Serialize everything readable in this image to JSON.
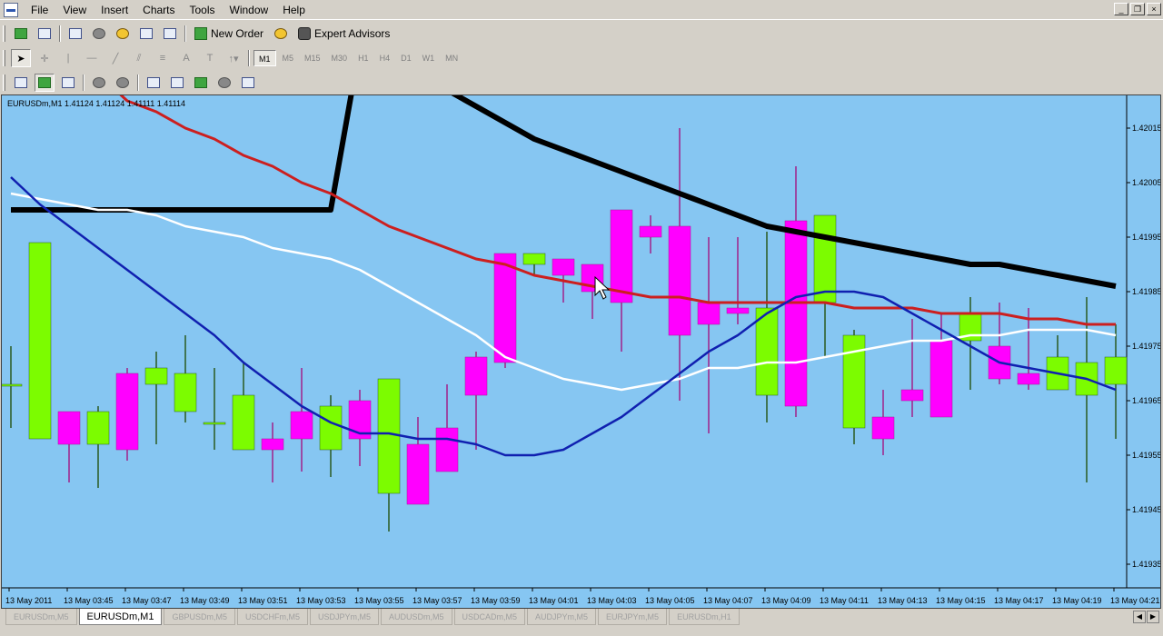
{
  "menubar": {
    "items": [
      "File",
      "View",
      "Insert",
      "Charts",
      "Tools",
      "Window",
      "Help"
    ]
  },
  "toolbar1": {
    "new_order_label": "New Order",
    "expert_advisors_label": "Expert Advisors"
  },
  "timeframes": [
    "M1",
    "M5",
    "M15",
    "M30",
    "H1",
    "H4",
    "D1",
    "W1",
    "MN"
  ],
  "active_timeframe": "M1",
  "chart": {
    "info_line": "EURUSDm,M1  1.41124  1.41124  1.41111  1.41114",
    "background": "#86c6f2",
    "bull_color": "#7cfc00",
    "bear_color": "#ff00ff",
    "cursor_icon": "arrow-cursor-icon"
  },
  "chart_data": {
    "type": "candlestick",
    "symbol": "EURUSDm",
    "timeframe": "M1",
    "ylim": [
      1.41935,
      1.42025
    ],
    "y_ticks": [
      "1.42015",
      "1.42005",
      "1.41995",
      "1.41985",
      "1.41975",
      "1.41965",
      "1.41955",
      "1.41945",
      "1.41935"
    ],
    "y_tick_values": [
      1.42015,
      1.42005,
      1.41995,
      1.41985,
      1.41975,
      1.41965,
      1.41955,
      1.41945,
      1.41935
    ],
    "x_labels": [
      "13 May 2011",
      "13 May 03:45",
      "13 May 03:47",
      "13 May 03:49",
      "13 May 03:51",
      "13 May 03:53",
      "13 May 03:55",
      "13 May 03:57",
      "13 May 03:59",
      "13 May 04:01",
      "13 May 04:03",
      "13 May 04:05",
      "13 May 04:07",
      "13 May 04:09",
      "13 May 04:11",
      "13 May 04:13",
      "13 May 04:15",
      "13 May 04:17",
      "13 May 04:19",
      "13 May 04:21"
    ],
    "candles": [
      {
        "o": 1.41968,
        "h": 1.41975,
        "l": 1.4196,
        "c": 1.41968
      },
      {
        "o": 1.41958,
        "h": 1.41994,
        "l": 1.41958,
        "c": 1.41994
      },
      {
        "o": 1.41963,
        "h": 1.41963,
        "l": 1.4195,
        "c": 1.41957
      },
      {
        "o": 1.41957,
        "h": 1.41964,
        "l": 1.41949,
        "c": 1.41963
      },
      {
        "o": 1.4197,
        "h": 1.41971,
        "l": 1.41954,
        "c": 1.41956
      },
      {
        "o": 1.41968,
        "h": 1.41974,
        "l": 1.41957,
        "c": 1.41971
      },
      {
        "o": 1.41963,
        "h": 1.41977,
        "l": 1.41961,
        "c": 1.4197
      },
      {
        "o": 1.41961,
        "h": 1.41971,
        "l": 1.41956,
        "c": 1.41961
      },
      {
        "o": 1.41956,
        "h": 1.41972,
        "l": 1.41956,
        "c": 1.41966
      },
      {
        "o": 1.41958,
        "h": 1.41961,
        "l": 1.4195,
        "c": 1.41956
      },
      {
        "o": 1.41963,
        "h": 1.41971,
        "l": 1.41952,
        "c": 1.41958
      },
      {
        "o": 1.41956,
        "h": 1.41966,
        "l": 1.41951,
        "c": 1.41964
      },
      {
        "o": 1.41965,
        "h": 1.41967,
        "l": 1.41953,
        "c": 1.41958
      },
      {
        "o": 1.41948,
        "h": 1.41968,
        "l": 1.41941,
        "c": 1.41969
      },
      {
        "o": 1.41957,
        "h": 1.41962,
        "l": 1.41947,
        "c": 1.41946
      },
      {
        "o": 1.4196,
        "h": 1.41968,
        "l": 1.41955,
        "c": 1.41952
      },
      {
        "o": 1.41973,
        "h": 1.41974,
        "l": 1.41956,
        "c": 1.41966
      },
      {
        "o": 1.41992,
        "h": 1.41992,
        "l": 1.41971,
        "c": 1.41972
      },
      {
        "o": 1.4199,
        "h": 1.41991,
        "l": 1.41988,
        "c": 1.41992
      },
      {
        "o": 1.41991,
        "h": 1.41989,
        "l": 1.41983,
        "c": 1.41988
      },
      {
        "o": 1.4199,
        "h": 1.41988,
        "l": 1.4198,
        "c": 1.41985
      },
      {
        "o": 1.42,
        "h": 1.42,
        "l": 1.41974,
        "c": 1.41983
      },
      {
        "o": 1.41997,
        "h": 1.41999,
        "l": 1.41992,
        "c": 1.41995
      },
      {
        "o": 1.41997,
        "h": 1.42015,
        "l": 1.41965,
        "c": 1.41977
      },
      {
        "o": 1.41983,
        "h": 1.41995,
        "l": 1.41959,
        "c": 1.41979
      },
      {
        "o": 1.41982,
        "h": 1.41995,
        "l": 1.41979,
        "c": 1.41981
      },
      {
        "o": 1.41966,
        "h": 1.41996,
        "l": 1.41961,
        "c": 1.41982
      },
      {
        "o": 1.41998,
        "h": 1.42008,
        "l": 1.41962,
        "c": 1.41964
      },
      {
        "o": 1.41983,
        "h": 1.41999,
        "l": 1.41973,
        "c": 1.41999
      },
      {
        "o": 1.4196,
        "h": 1.41978,
        "l": 1.41957,
        "c": 1.41977
      },
      {
        "o": 1.41962,
        "h": 1.41967,
        "l": 1.41955,
        "c": 1.41958
      },
      {
        "o": 1.41967,
        "h": 1.4198,
        "l": 1.41962,
        "c": 1.41965
      },
      {
        "o": 1.41976,
        "h": 1.41981,
        "l": 1.41962,
        "c": 1.41962
      },
      {
        "o": 1.41976,
        "h": 1.41984,
        "l": 1.41967,
        "c": 1.41981
      },
      {
        "o": 1.41975,
        "h": 1.41983,
        "l": 1.41968,
        "c": 1.41969
      },
      {
        "o": 1.4197,
        "h": 1.41982,
        "l": 1.41967,
        "c": 1.41968
      },
      {
        "o": 1.41967,
        "h": 1.41977,
        "l": 1.41968,
        "c": 1.41973
      },
      {
        "o": 1.41966,
        "h": 1.41984,
        "l": 1.4195,
        "c": 1.41972
      },
      {
        "o": 1.41968,
        "h": 1.41979,
        "l": 1.41958,
        "c": 1.41973
      }
    ],
    "series": [
      {
        "name": "",
        "color": "#000000",
        "values": [
          1.42,
          1.42,
          1.42,
          1.42,
          1.42,
          1.42,
          1.42,
          1.42,
          1.42,
          1.42,
          1.42,
          1.42,
          1.4203,
          1.42028,
          1.42025,
          1.42022,
          1.42019,
          1.42016,
          1.42013,
          1.42011,
          1.42009,
          1.42007,
          1.42005,
          1.42003,
          1.42001,
          1.41999,
          1.41997,
          1.41996,
          1.41995,
          1.41994,
          1.41993,
          1.41992,
          1.41991,
          1.4199,
          1.4199,
          1.41989,
          1.41988,
          1.41987,
          1.41986
        ]
      },
      {
        "name": "",
        "color": "#cc1f1f",
        "values": [
          1.42025,
          1.42025,
          1.42025,
          1.42025,
          1.4202,
          1.42018,
          1.42015,
          1.42013,
          1.4201,
          1.42008,
          1.42005,
          1.42003,
          1.42,
          1.41997,
          1.41995,
          1.41993,
          1.41991,
          1.4199,
          1.41988,
          1.41987,
          1.41986,
          1.41985,
          1.41984,
          1.41984,
          1.41983,
          1.41983,
          1.41983,
          1.41983,
          1.41983,
          1.41982,
          1.41982,
          1.41982,
          1.41981,
          1.41981,
          1.41981,
          1.4198,
          1.4198,
          1.41979,
          1.41979
        ]
      },
      {
        "name": "",
        "color": "#ffffff",
        "values": [
          1.42003,
          1.42002,
          1.42001,
          1.42,
          1.42,
          1.41999,
          1.41997,
          1.41996,
          1.41995,
          1.41993,
          1.41992,
          1.41991,
          1.41989,
          1.41986,
          1.41983,
          1.4198,
          1.41977,
          1.41973,
          1.41971,
          1.41969,
          1.41968,
          1.41967,
          1.41968,
          1.41969,
          1.41971,
          1.41971,
          1.41972,
          1.41972,
          1.41973,
          1.41974,
          1.41975,
          1.41976,
          1.41976,
          1.41977,
          1.41977,
          1.41978,
          1.41978,
          1.41978,
          1.41977
        ]
      },
      {
        "name": "",
        "color": "#1020b0",
        "values": [
          1.42006,
          1.42001,
          1.41997,
          1.41993,
          1.41989,
          1.41985,
          1.41981,
          1.41977,
          1.41972,
          1.41968,
          1.41964,
          1.41961,
          1.41959,
          1.41959,
          1.41958,
          1.41958,
          1.41957,
          1.41955,
          1.41955,
          1.41956,
          1.41959,
          1.41962,
          1.41966,
          1.4197,
          1.41974,
          1.41977,
          1.41981,
          1.41984,
          1.41985,
          1.41985,
          1.41984,
          1.41981,
          1.41978,
          1.41975,
          1.41972,
          1.41971,
          1.4197,
          1.41969,
          1.41967
        ]
      }
    ]
  },
  "tabs": [
    "EURUSDm,M5",
    "EURUSDm,M1",
    "GBPUSDm,M5",
    "USDCHFm,M5",
    "USDJPYm,M5",
    "AUDUSDm,M5",
    "USDCADm,M5",
    "AUDJPYm,M5",
    "EURJPYm,M5",
    "EURUSDm,H1"
  ],
  "active_tab_index": 1
}
